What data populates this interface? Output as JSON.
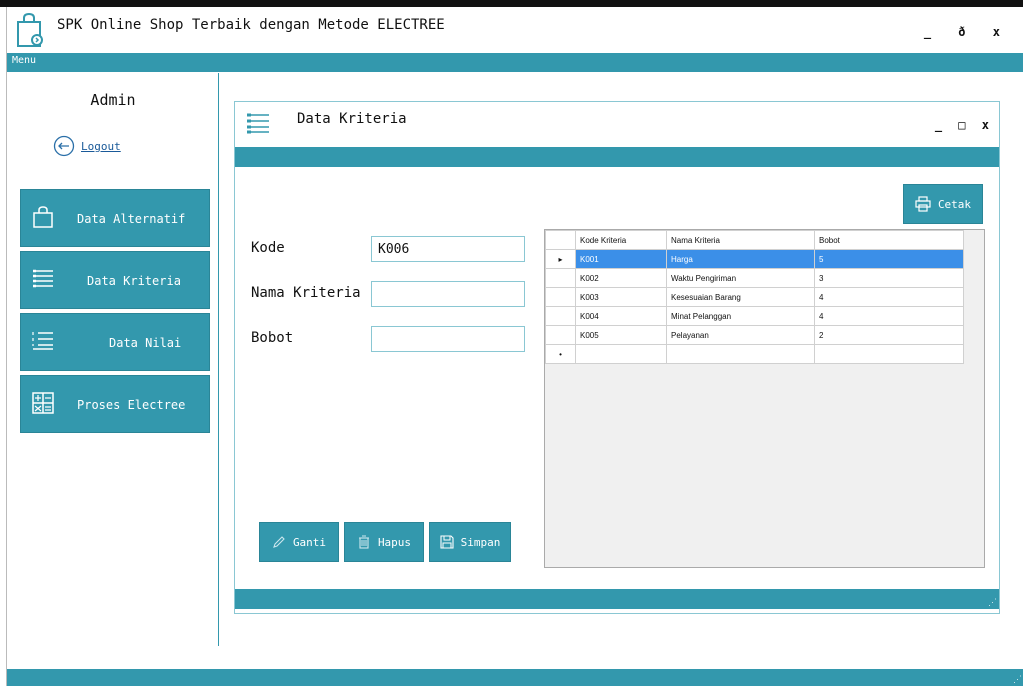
{
  "app": {
    "title": "SPK Online Shop Terbaik dengan Metode ELECTREE",
    "controls": {
      "minimize": "_",
      "restore": "ð",
      "close": "x"
    }
  },
  "menubar": {
    "menu_label": "Menu"
  },
  "sidebar": {
    "user": "Admin",
    "logout_label": "Logout",
    "items": [
      {
        "label": "Data Alternatif",
        "icon": "shopping-bag-icon"
      },
      {
        "label": "Data Kriteria",
        "icon": "list-icon"
      },
      {
        "label": "Data Nilai",
        "icon": "numbered-list-icon"
      },
      {
        "label": "Proses Electree",
        "icon": "calculator-icon"
      }
    ]
  },
  "child_window": {
    "title": "Data Kriteria",
    "controls": {
      "minimize": "_",
      "maximize": "□",
      "close": "x"
    }
  },
  "form": {
    "kode_label": "Kode",
    "kode_value": "K006",
    "nama_label": "Nama Kriteria",
    "nama_value": "",
    "bobot_label": "Bobot",
    "bobot_value": ""
  },
  "buttons": {
    "cetak": "Cetak",
    "ganti": "Ganti",
    "hapus": "Hapus",
    "simpan": "Simpan"
  },
  "grid": {
    "columns": [
      "Kode Kriteria",
      "Nama Kriteria",
      "Bobot"
    ],
    "rows": [
      [
        "K001",
        "Harga",
        "5"
      ],
      [
        "K002",
        "Waktu Pengiriman",
        "3"
      ],
      [
        "K003",
        "Kesesuaian Barang",
        "4"
      ],
      [
        "K004",
        "Minat Pelanggan",
        "4"
      ],
      [
        "K005",
        "Pelayanan",
        "2"
      ]
    ],
    "selected_row": 0,
    "current_row_marker": "▸",
    "new_row_marker": "•"
  },
  "colors": {
    "accent": "#3398ad",
    "selection": "#3b8fe8"
  }
}
